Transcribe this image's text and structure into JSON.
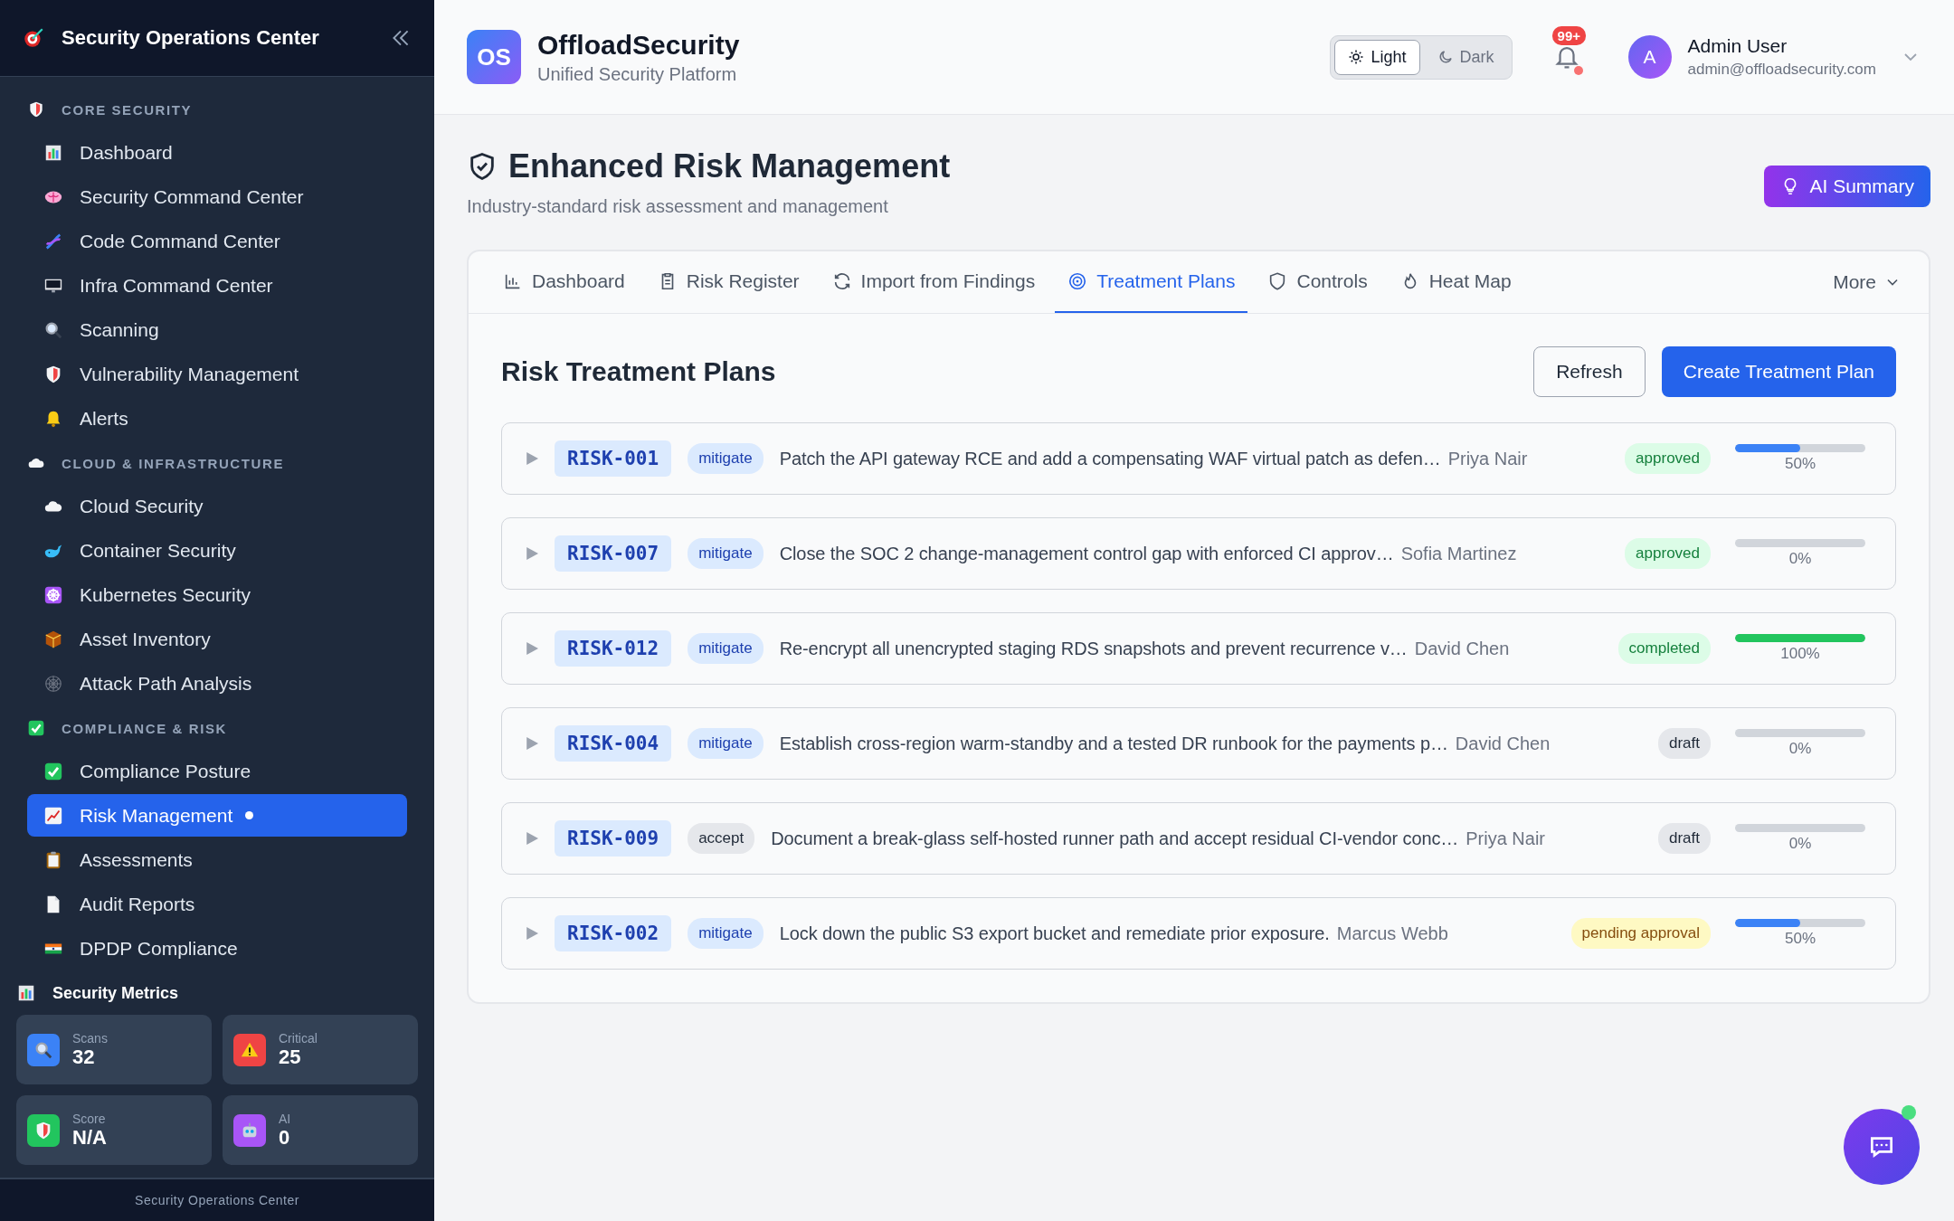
{
  "sidebar": {
    "title": "Security Operations Center",
    "sections": [
      {
        "heading": "CORE SECURITY",
        "items": [
          {
            "label": "Dashboard",
            "selected": false
          },
          {
            "label": "Security Command Center",
            "selected": false
          },
          {
            "label": "Code Command Center",
            "selected": false
          },
          {
            "label": "Infra Command Center",
            "selected": false
          },
          {
            "label": "Scanning",
            "selected": false
          },
          {
            "label": "Vulnerability Management",
            "selected": false
          },
          {
            "label": "Alerts",
            "selected": false
          }
        ]
      },
      {
        "heading": "CLOUD & INFRASTRUCTURE",
        "items": [
          {
            "label": "Cloud Security",
            "selected": false
          },
          {
            "label": "Container Security",
            "selected": false
          },
          {
            "label": "Kubernetes Security",
            "selected": false
          },
          {
            "label": "Asset Inventory",
            "selected": false
          },
          {
            "label": "Attack Path Analysis",
            "selected": false
          }
        ]
      },
      {
        "heading": "COMPLIANCE & RISK",
        "items": [
          {
            "label": "Compliance Posture",
            "selected": false
          },
          {
            "label": "Risk Management",
            "selected": true
          },
          {
            "label": "Assessments",
            "selected": false
          },
          {
            "label": "Audit Reports",
            "selected": false
          },
          {
            "label": "DPDP Compliance",
            "selected": false
          }
        ]
      }
    ],
    "metrics_title": "Security Metrics",
    "metrics": [
      {
        "label": "Scans",
        "value": "32",
        "color": "#3b82f6"
      },
      {
        "label": "Critical",
        "value": "25",
        "color": "#ef4444"
      },
      {
        "label": "Score",
        "value": "N/A",
        "color": "#22c55e"
      },
      {
        "label": "AI",
        "value": "0",
        "color": "#a855f7"
      }
    ],
    "footer": "Security Operations Center"
  },
  "header": {
    "logo": "OS",
    "brand": "OffloadSecurity",
    "tagline": "Unified Security Platform",
    "theme": [
      {
        "label": "Light",
        "selected": true
      },
      {
        "label": "Dark",
        "selected": false
      }
    ],
    "notifications": "99+",
    "avatar": "A",
    "user_name": "Admin User",
    "user_email": "admin@offloadsecurity.com"
  },
  "page": {
    "title": "Enhanced Risk Management",
    "subtitle": "Industry-standard risk assessment and management",
    "ai_button": "AI Summary"
  },
  "tabs": [
    {
      "label": "Dashboard",
      "selected": false
    },
    {
      "label": "Risk Register",
      "selected": false
    },
    {
      "label": "Import from Findings",
      "selected": false
    },
    {
      "label": "Treatment Plans",
      "selected": true
    },
    {
      "label": "Controls",
      "selected": false
    },
    {
      "label": "Heat Map",
      "selected": false
    }
  ],
  "more": "More",
  "panel": {
    "title": "Risk Treatment Plans",
    "buttons": [
      "Refresh",
      "Create Treatment Plan"
    ]
  },
  "plans": [
    {
      "id": "RISK-001",
      "type": {
        "label": "mitigate",
        "color": "#dbeafe"
      },
      "description": "Patch the API gateway RCE and add a compensating WAF virtual patch as defen…",
      "owner": "Priya Nair",
      "status": {
        "label": "approved",
        "color": "#dcfce7"
      },
      "level": 0.5,
      "percent": "50%"
    },
    {
      "id": "RISK-007",
      "type": {
        "label": "mitigate",
        "color": "#dbeafe"
      },
      "description": "Close the SOC 2 change-management control gap with enforced CI approv…",
      "owner": "Sofia Martinez",
      "status": {
        "label": "approved",
        "color": "#dcfce7"
      },
      "level": 0,
      "percent": "0%"
    },
    {
      "id": "RISK-012",
      "type": {
        "label": "mitigate",
        "color": "#dbeafe"
      },
      "description": "Re-encrypt all unencrypted staging RDS snapshots and prevent recurrence v…",
      "owner": "David Chen",
      "status": {
        "label": "completed",
        "color": "#dcfce7"
      },
      "level": 1,
      "percent": "100%"
    },
    {
      "id": "RISK-004",
      "type": {
        "label": "mitigate",
        "color": "#dbeafe"
      },
      "description": "Establish cross-region warm-standby and a tested DR runbook for the payments p…",
      "owner": "David Chen",
      "status": {
        "label": "draft",
        "color": "#e5e7eb"
      },
      "level": 0,
      "percent": "0%"
    },
    {
      "id": "RISK-009",
      "type": {
        "label": "accept",
        "color": "#e5e7eb"
      },
      "description": "Document a break-glass self-hosted runner path and accept residual CI-vendor conc…",
      "owner": "Priya Nair",
      "status": {
        "label": "draft",
        "color": "#e5e7eb"
      },
      "level": 0,
      "percent": "0%"
    },
    {
      "id": "RISK-002",
      "type": {
        "label": "mitigate",
        "color": "#dbeafe"
      },
      "description": "Lock down the public S3 export bucket and remediate prior exposure.",
      "owner": "Marcus Webb",
      "status": {
        "label": "pending approval",
        "color": "#fef9c3"
      },
      "level": 0.5,
      "percent": "50%"
    }
  ]
}
